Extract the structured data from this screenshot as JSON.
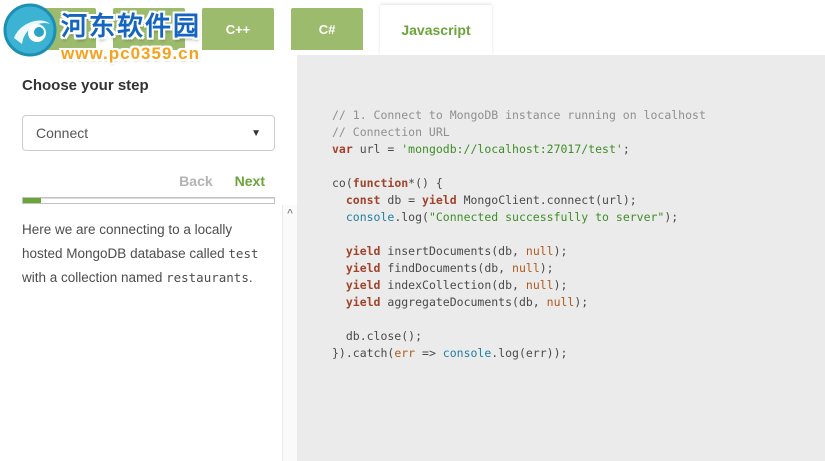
{
  "colors": {
    "accent": "#6ba43a",
    "tab-bg": "#9cbb6d",
    "code-bg": "#ebebeb",
    "code-comment": "#8f8f8f",
    "code-keyword": "#a0432a",
    "code-string": "#3f8e27",
    "code-builtin": "#1f7f9f",
    "code-literal": "#b05a1e",
    "code-plain": "#4a4a4a"
  },
  "watermark": {
    "site_name": "河东软件园",
    "site_url": "www.pc0359.cn"
  },
  "tabs": [
    {
      "label": "",
      "active": false
    },
    {
      "label": "",
      "active": false
    },
    {
      "label": "C++",
      "active": false
    },
    {
      "label": "C#",
      "active": false
    },
    {
      "label": "Javascript",
      "active": true
    }
  ],
  "sidebar": {
    "heading": "Choose your step",
    "step_dropdown": {
      "selected": "Connect"
    },
    "back_label": "Back",
    "next_label": "Next",
    "progress_percent": 7,
    "description": [
      {
        "text": "Here we are connecting to a locally hosted MongoDB database called ",
        "mono": false
      },
      {
        "text": "test",
        "mono": true
      },
      {
        "text": " with a collection named ",
        "mono": false
      },
      {
        "text": "restaurants",
        "mono": true
      },
      {
        "text": ".",
        "mono": false
      }
    ],
    "scroll_up_glyph": "^"
  },
  "code": {
    "lines": [
      [
        {
          "c": "cm",
          "t": "// 1. Connect to MongoDB instance running on localhost"
        }
      ],
      [
        {
          "c": "cm",
          "t": "// Connection URL"
        }
      ],
      [
        {
          "c": "kw",
          "t": "var"
        },
        {
          "c": "pl",
          "t": " url = "
        },
        {
          "c": "st",
          "t": "'mongodb://localhost:27017/test'"
        },
        {
          "c": "pl",
          "t": ";"
        }
      ],
      [],
      [
        {
          "c": "pl",
          "t": "co("
        },
        {
          "c": "kw",
          "t": "function"
        },
        {
          "c": "pl",
          "t": "*() {"
        }
      ],
      [
        {
          "c": "pl",
          "t": "  "
        },
        {
          "c": "kw",
          "t": "const"
        },
        {
          "c": "pl",
          "t": " db = "
        },
        {
          "c": "kw",
          "t": "yield"
        },
        {
          "c": "pl",
          "t": " MongoClient.connect(url);"
        }
      ],
      [
        {
          "c": "pl",
          "t": "  "
        },
        {
          "c": "bi",
          "t": "console"
        },
        {
          "c": "pl",
          "t": ".log("
        },
        {
          "c": "st",
          "t": "\"Connected successfully to server\""
        },
        {
          "c": "pl",
          "t": ");"
        }
      ],
      [],
      [
        {
          "c": "pl",
          "t": "  "
        },
        {
          "c": "kw",
          "t": "yield"
        },
        {
          "c": "pl",
          "t": " insertDocuments(db, "
        },
        {
          "c": "li",
          "t": "null"
        },
        {
          "c": "pl",
          "t": ");"
        }
      ],
      [
        {
          "c": "pl",
          "t": "  "
        },
        {
          "c": "kw",
          "t": "yield"
        },
        {
          "c": "pl",
          "t": " findDocuments(db, "
        },
        {
          "c": "li",
          "t": "null"
        },
        {
          "c": "pl",
          "t": ");"
        }
      ],
      [
        {
          "c": "pl",
          "t": "  "
        },
        {
          "c": "kw",
          "t": "yield"
        },
        {
          "c": "pl",
          "t": " indexCollection(db, "
        },
        {
          "c": "li",
          "t": "null"
        },
        {
          "c": "pl",
          "t": ");"
        }
      ],
      [
        {
          "c": "pl",
          "t": "  "
        },
        {
          "c": "kw",
          "t": "yield"
        },
        {
          "c": "pl",
          "t": " aggregateDocuments(db, "
        },
        {
          "c": "li",
          "t": "null"
        },
        {
          "c": "pl",
          "t": ");"
        }
      ],
      [],
      [
        {
          "c": "pl",
          "t": "  db.close();"
        }
      ],
      [
        {
          "c": "pl",
          "t": "}).catch("
        },
        {
          "c": "li",
          "t": "err"
        },
        {
          "c": "pl",
          "t": " => "
        },
        {
          "c": "bi",
          "t": "console"
        },
        {
          "c": "pl",
          "t": ".log(err));"
        }
      ]
    ]
  }
}
